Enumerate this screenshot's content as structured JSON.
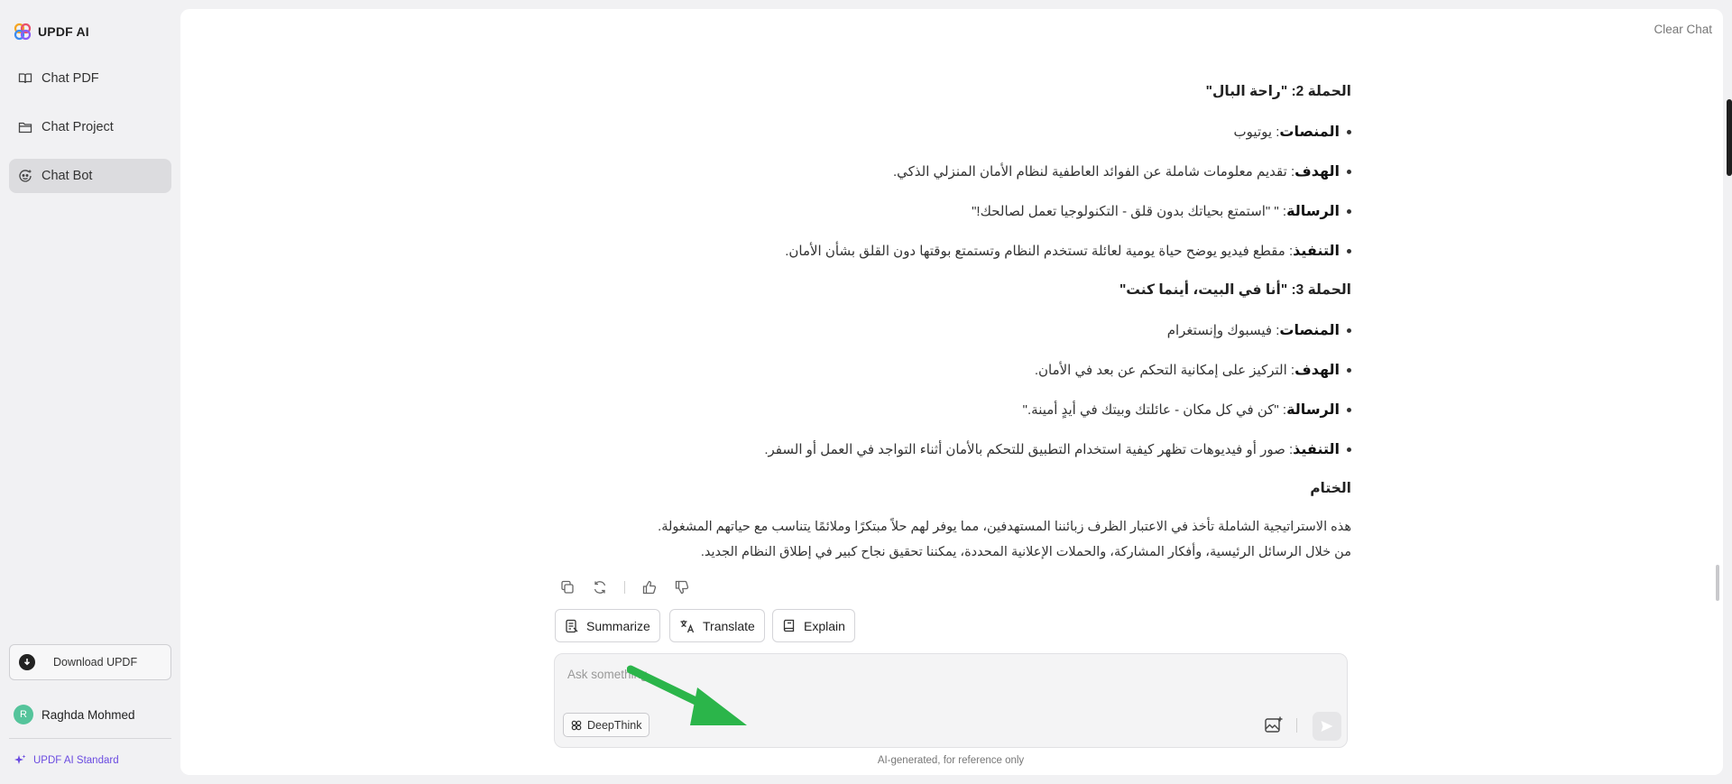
{
  "app": {
    "title": "UPDF AI"
  },
  "sidebar": {
    "items": [
      {
        "label": "Chat PDF",
        "icon": "book-icon"
      },
      {
        "label": "Chat Project",
        "icon": "folder-icon"
      },
      {
        "label": "Chat Bot",
        "icon": "bot-icon",
        "active": true
      }
    ],
    "download_label": "Download UPDF",
    "user": {
      "initial": "R",
      "name": "Raghda Mohmed"
    },
    "plan_label": "UPDF AI Standard"
  },
  "header": {
    "clear_chat": "Clear Chat"
  },
  "answer": {
    "campaign2": {
      "heading": "الحملة 2: \"راحة البال\"",
      "items": [
        {
          "label": "المنصات",
          "text": " : يوتيوب"
        },
        {
          "label": "الهدف",
          "text": " : تقديم معلومات شاملة عن الفوائد العاطفية لنظام الأمان المنزلي الذكي."
        },
        {
          "label": "الرسالة",
          "text": " : \" \"استمتع بحياتك بدون قلق - التكنولوجيا تعمل لصالحك!\""
        },
        {
          "label": "التنفيذ",
          "text": " : مقطع فيديو يوضح حياة يومية لعائلة تستخدم النظام وتستمتع بوقتها دون القلق بشأن الأمان."
        }
      ]
    },
    "campaign3": {
      "heading": "الحملة 3: \"أنا في البيت، أينما كنت\"",
      "items": [
        {
          "label": "المنصات",
          "text": " : فيسبوك وإنستغرام"
        },
        {
          "label": "الهدف",
          "text": " : التركيز على إمكانية التحكم عن بعد في الأمان."
        },
        {
          "label": "الرسالة",
          "text": " : \"كن في كل مكان - عائلتك وبيتك في أيدٍ أمينة.\""
        },
        {
          "label": "التنفيذ",
          "text": " : صور أو فيديوهات تظهر كيفية استخدام التطبيق للتحكم بالأمان أثناء التواجد في العمل أو السفر."
        }
      ]
    },
    "conclusion": {
      "heading": "الختام",
      "line1": "هذه الاستراتيجية الشاملة تأخذ في الاعتبار الظرف زبائننا المستهدفين، مما يوفر لهم حلاً مبتكرًا وملائمًا يتناسب مع حياتهم المشغولة.",
      "line2": "من خلال الرسائل الرئيسية، وأفكار المشاركة، والحملات الإعلانية المحددة، يمكننا تحقيق نجاح كبير في إطلاق النظام الجديد."
    }
  },
  "quick_actions": {
    "summarize": "Summarize",
    "translate": "Translate",
    "explain": "Explain"
  },
  "composer": {
    "placeholder": "Ask something",
    "deepthink_label": "DeepThink",
    "disclaimer": "AI-generated, for reference only"
  },
  "colors": {
    "accent": "#6a4be0",
    "arrow": "#2bb54a",
    "avatar": "#55c49b"
  }
}
